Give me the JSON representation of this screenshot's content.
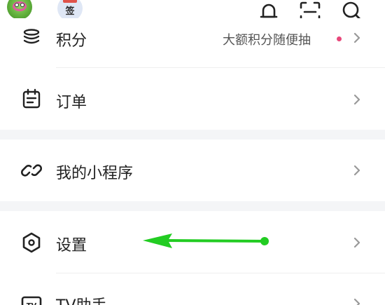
{
  "header": {
    "sign_badge_text": "签",
    "icons": [
      "game-avatar-icon",
      "sign-in-icon",
      "bell-icon",
      "scan-icon",
      "search-icon"
    ]
  },
  "menu": [
    {
      "label": "积分",
      "subtitle": "大额积分随便抽",
      "has_dot": true,
      "icon": "coins-stack-icon"
    },
    {
      "label": "订单",
      "icon": "order-clipboard-icon"
    },
    {
      "label": "我的小程序",
      "icon": "mini-program-link-icon"
    },
    {
      "label": "设置",
      "icon": "settings-hexagon-icon"
    },
    {
      "label": "TV助手",
      "icon": "tv-icon"
    }
  ],
  "colors": {
    "background": "#ffffff",
    "section_gap": "#f4f5f7",
    "text": "#222222",
    "subtext": "#555555",
    "dot": "#e8477a",
    "annotation_arrow": "#22cc22",
    "chevron": "#999999"
  }
}
